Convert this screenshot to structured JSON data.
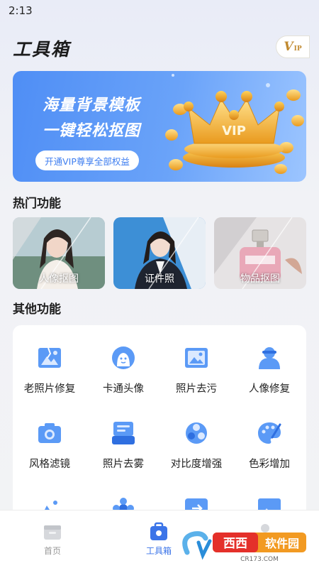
{
  "status": {
    "time": "2:13"
  },
  "header": {
    "title": "工具箱",
    "vip_badge": {
      "v": "V",
      "ip": "IP"
    }
  },
  "banner": {
    "line1": "海量背景模板",
    "line2": "一键轻松抠图",
    "button": "开通VIP尊享全部权益",
    "crown_text": "VIP"
  },
  "hot": {
    "title": "热门功能",
    "items": [
      {
        "label": "人像抠图"
      },
      {
        "label": "证件照"
      },
      {
        "label": "物品抠图"
      }
    ]
  },
  "other": {
    "title": "其他功能",
    "items": [
      {
        "label": "老照片修复",
        "icon": "old-photo-icon"
      },
      {
        "label": "卡通头像",
        "icon": "cartoon-avatar-icon"
      },
      {
        "label": "照片去污",
        "icon": "photo-clean-icon"
      },
      {
        "label": "人像修复",
        "icon": "portrait-repair-icon"
      },
      {
        "label": "风格滤镜",
        "icon": "camera-filter-icon"
      },
      {
        "label": "照片去雾",
        "icon": "dehaze-icon"
      },
      {
        "label": "对比度增强",
        "icon": "contrast-icon"
      },
      {
        "label": "色彩增加",
        "icon": "palette-icon"
      }
    ]
  },
  "nav": {
    "items": [
      {
        "label": "首页",
        "active": false
      },
      {
        "label": "工具箱",
        "active": true
      },
      {
        "label": "",
        "active": false
      }
    ]
  },
  "watermark": {
    "brand": "西西软件园",
    "site": "CR173.COM"
  },
  "colors": {
    "accent": "#3b74e8",
    "banner": "#4f8ef5",
    "gold": "#f2b536",
    "icon_blue": "#5b9af6"
  }
}
